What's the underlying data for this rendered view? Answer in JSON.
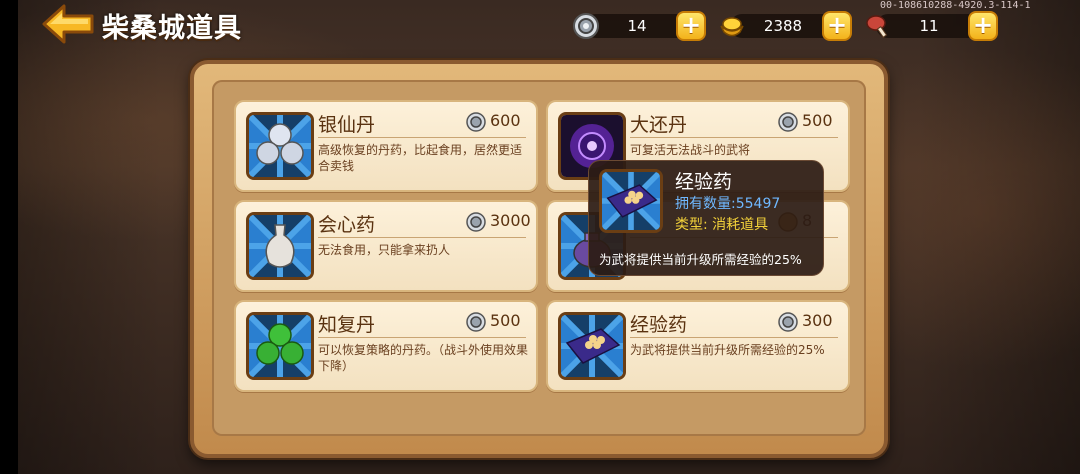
{
  "header": {
    "title": "柴桑城道具",
    "version": "00-108610288-4920.3-114-1",
    "resources": [
      {
        "icon": "silver-coin-icon",
        "value": "14"
      },
      {
        "icon": "gold-ingot-icon",
        "value": "2388"
      },
      {
        "icon": "meat-icon",
        "value": "11"
      }
    ],
    "plus_label": "+"
  },
  "items": [
    {
      "name": "银仙丹",
      "price": "600",
      "desc": "高级恢复的丹药，比起食用，居然更适合卖钱",
      "icon": "silver-pills-icon"
    },
    {
      "name": "大还丹",
      "price": "500",
      "desc": "可复活无法战斗的武将",
      "icon": "purple-orb-icon"
    },
    {
      "name": "会心药",
      "price": "3000",
      "desc": "无法食用，只能拿来扔人",
      "icon": "white-vase-icon"
    },
    {
      "name": "",
      "price": "8",
      "desc": "",
      "icon": "purple-pot-icon"
    },
    {
      "name": "知复丹",
      "price": "500",
      "desc": "可以恢复策略的丹药。（战斗外使用效果下降）",
      "icon": "green-pills-icon"
    },
    {
      "name": "经验药",
      "price": "300",
      "desc": "为武将提供当前升级所需经验的25%",
      "icon": "exp-cloth-icon"
    }
  ],
  "tooltip": {
    "name": "经验药",
    "count": "拥有数量:55497",
    "type": "类型: 消耗道具",
    "desc": "为武将提供当前升级所需经验的25%",
    "icon": "exp-cloth-icon"
  },
  "colors": {
    "panel": "#d9ac6e",
    "card": "#fbeed3",
    "tooltip_bg": "#2c1c14",
    "count_text": "#6fb8ff",
    "type_text": "#f3d23a"
  }
}
